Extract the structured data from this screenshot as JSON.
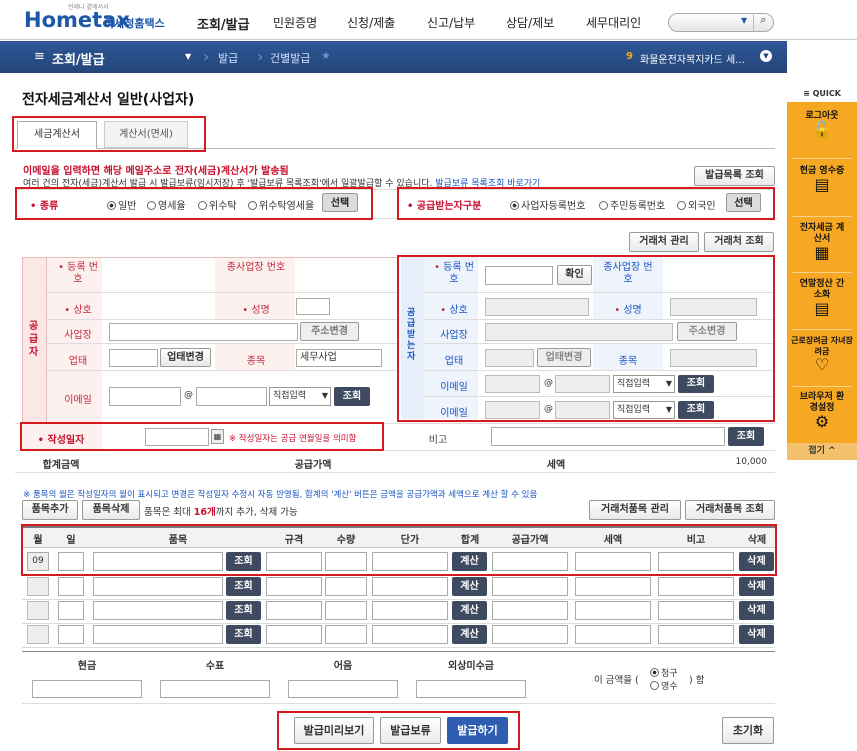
{
  "header": {
    "logo": "Hometax",
    "logo_sub": "국세청홈택스",
    "logo_tiny": "언제나 곁에서서",
    "nav": [
      "조회/발급",
      "민원증명",
      "신청/제출",
      "신고/납부",
      "상담/제보",
      "세무대리인"
    ]
  },
  "subbar": {
    "menu": "조회/발급",
    "crumb1": "발급",
    "crumb2": "건별발급",
    "badge": "9",
    "notice": "화물운전자복지카드 세..."
  },
  "quick": {
    "title": "QUICK",
    "items": [
      "로그아웃",
      "현금 영수증",
      "전자세금 계산서",
      "연말정산 간소화",
      "근로장려금 자녀장려금",
      "브라우저 환경설정"
    ],
    "fold": "접기"
  },
  "page": {
    "title": "전자세금계산서 일반(사업자)",
    "tab1": "세금계산서",
    "tab2": "계산서(면세)",
    "notice1": "이메일을 입력하면 해당 메일주소로 전자(세금)계산서가 발송됨",
    "notice2": "여러 건의 전자(세금)계산서 발급 시 발급보류(임시저장) 후 '발급보류 목록조회'에서 일괄발급할 수 있습니다.",
    "notice2_link": "발급보류 목록조회 바로가기",
    "list_btn": "발급목록 조회"
  },
  "kind": {
    "label": "종류",
    "opts": [
      "일반",
      "영세율",
      "위수탁",
      "위수탁영세율"
    ],
    "select": "선택"
  },
  "recv_type": {
    "label": "공급받는자구분",
    "opts": [
      "사업자등록번호",
      "주민등록번호",
      "외국인"
    ],
    "select": "선택"
  },
  "partner": {
    "manage": "거래처 관리",
    "search": "거래처 조회"
  },
  "supplier": {
    "side": "공급자",
    "reg": "등록 번호",
    "subreg": "종사업장 번호",
    "name": "상호",
    "owner": "성명",
    "addr": "사업장",
    "addr_btn": "주소변경",
    "biz": "업태",
    "biz_btn": "업태변경",
    "item": "종목",
    "item_val": "세무사업",
    "email": "이메일",
    "at": "@",
    "direct": "직접입력",
    "lookup": "조회"
  },
  "buyer": {
    "side": "공급받는자",
    "reg": "등록 번호",
    "confirm": "확인",
    "subreg": "종사업장 번호",
    "name": "상호",
    "owner": "성명",
    "addr": "사업장",
    "addr_btn": "주소변경",
    "biz": "업태",
    "biz_btn": "업태변경",
    "item": "종목",
    "email": "이메일",
    "at": "@",
    "direct": "직접입력",
    "lookup": "조회"
  },
  "date": {
    "label": "작성일자",
    "hint": "※ 작성일자는 공급 연월일을 의미함",
    "remark": "비고",
    "lookup": "조회"
  },
  "totals": {
    "total": "합계금액",
    "supply": "공급가액",
    "tax": "세액",
    "tax_val": "10,000"
  },
  "items": {
    "note": "※ 품목의 월은 작성일자의 월이 표시되고 변경은 작성일자 수정시 자동 반영됨, 합계의 '계산' 버튼은 금액을 공급가액과 세액으로 계산 할 수 있음",
    "add": "품목추가",
    "del": "품목삭제",
    "limit_pre": "품목은 최대",
    "limit_num": "16개",
    "limit_post": "까지 추가, 삭제 가능",
    "manage": "거래처품목 관리",
    "search": "거래처품목 조회",
    "cols": [
      "월",
      "일",
      "품목",
      "규격",
      "수량",
      "단가",
      "합계",
      "공급가액",
      "세액",
      "비고",
      "삭제"
    ],
    "month": "09",
    "lookup": "조회",
    "calc": "계산",
    "delete": "삭제"
  },
  "pay": {
    "cols": [
      "현금",
      "수표",
      "어음",
      "외상미수금"
    ],
    "pre": "이 금액을 (",
    "claim": "청구",
    "receipt": "영수",
    "post": ") 함"
  },
  "actions": {
    "preview": "발급미리보기",
    "hold": "발급보류",
    "issue": "발급하기",
    "reset": "초기화"
  }
}
